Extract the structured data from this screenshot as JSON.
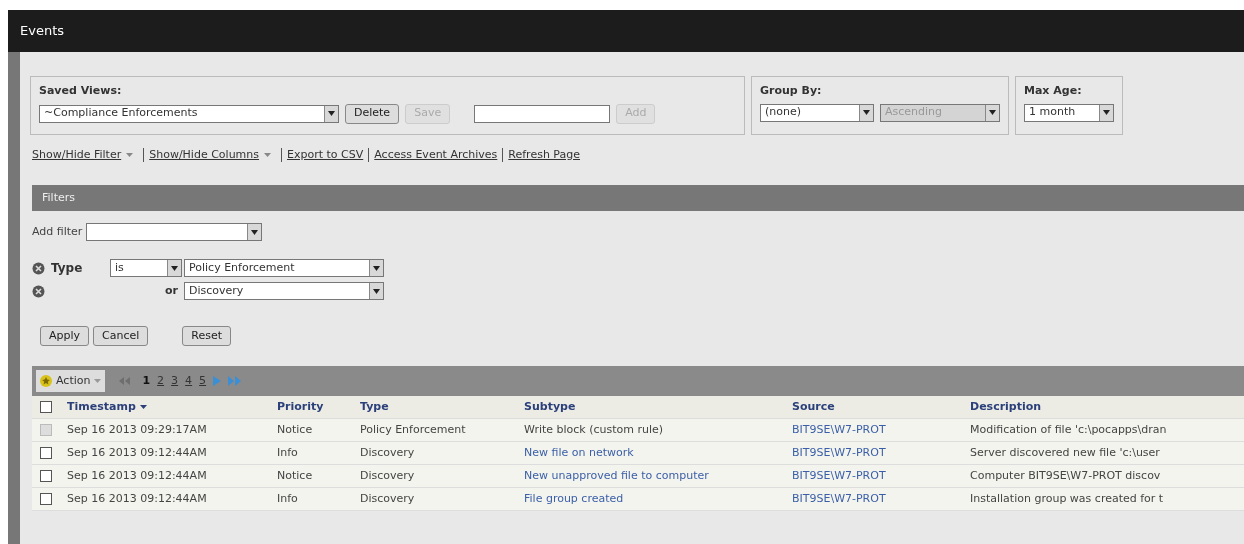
{
  "window": {
    "title": "Events"
  },
  "saved_views": {
    "label": "Saved Views:",
    "value": "~Compliance Enforcements",
    "buttons": [
      {
        "label": "Delete",
        "disabled": false
      },
      {
        "label": "Save",
        "disabled": true
      }
    ],
    "add_button": {
      "label": "Add",
      "disabled": true
    }
  },
  "group_by": {
    "label": "Group By:",
    "value": "(none)",
    "order": "Ascending",
    "order_disabled": true
  },
  "max_age": {
    "label": "Max Age:",
    "value": "1 month"
  },
  "links": [
    {
      "label": "Show/Hide Filter",
      "dropdown": true
    },
    {
      "label": "Show/Hide Columns",
      "dropdown": true
    },
    {
      "label": "Export to CSV",
      "dropdown": false
    },
    {
      "label": "Access Event Archives",
      "dropdown": false
    },
    {
      "label": "Refresh Page",
      "dropdown": false
    }
  ],
  "filters": {
    "title": "Filters",
    "add_filter_label": "Add filter",
    "conditions": [
      {
        "field": "Type",
        "operator": "is",
        "value": "Policy Enforcement"
      },
      {
        "operator": "or",
        "value": "Discovery"
      }
    ],
    "buttons": [
      "Apply",
      "Cancel",
      "Reset"
    ]
  },
  "toolbar": {
    "action": "Action",
    "pages": [
      {
        "label": "1",
        "selected": true
      },
      {
        "label": "2",
        "selected": false
      },
      {
        "label": "3",
        "selected": false
      },
      {
        "label": "4",
        "selected": false
      },
      {
        "label": "5",
        "selected": false
      }
    ]
  },
  "table": {
    "all_checked": false,
    "columns": [
      "Timestamp",
      "Priority",
      "Type",
      "Subtype",
      "Source",
      "Description"
    ],
    "rows": [
      {
        "checked": false,
        "disabled": true,
        "cells": [
          "Sep 16 2013 09:29:17AM",
          "Notice",
          "Policy Enforcement",
          "Write block (custom rule)",
          "BIT9SE\\W7-PROT",
          "Modification of file 'c:\\pocapps\\dran"
        ],
        "subtype_link": false
      },
      {
        "checked": false,
        "disabled": false,
        "cells": [
          "Sep 16 2013 09:12:44AM",
          "Info",
          "Discovery",
          "New file on network",
          "BIT9SE\\W7-PROT",
          "Server discovered new file 'c:\\user"
        ],
        "subtype_link": true
      },
      {
        "checked": false,
        "disabled": false,
        "cells": [
          "Sep 16 2013 09:12:44AM",
          "Notice",
          "Discovery",
          "New unapproved file to computer",
          "BIT9SE\\W7-PROT",
          "Computer BIT9SE\\W7-PROT discov"
        ],
        "subtype_link": true
      },
      {
        "checked": false,
        "disabled": false,
        "cells": [
          "Sep 16 2013 09:12:44AM",
          "Info",
          "Discovery",
          "File group created",
          "BIT9SE\\W7-PROT",
          "Installation group was created for t"
        ],
        "subtype_link": true
      }
    ]
  }
}
